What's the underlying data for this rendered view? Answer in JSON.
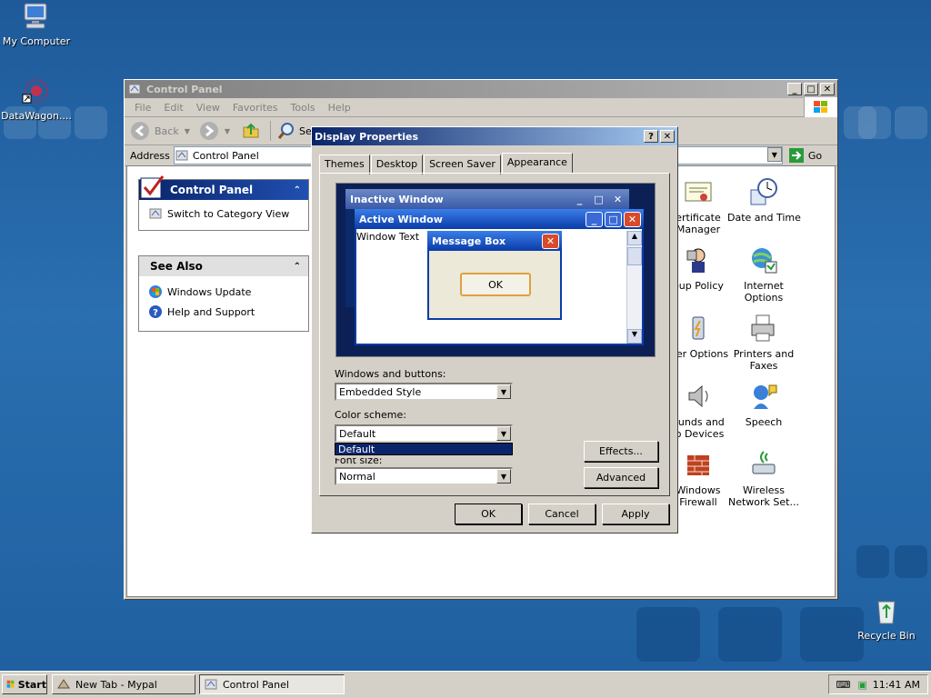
{
  "desktop": {
    "icons": [
      {
        "label": "My Computer"
      },
      {
        "label": "DataWagon...."
      },
      {
        "label": "Recycle Bin"
      }
    ]
  },
  "control_panel": {
    "title": "Control Panel",
    "menu": [
      "File",
      "Edit",
      "View",
      "Favorites",
      "Tools",
      "Help"
    ],
    "toolbar": {
      "back": "Back",
      "search": "Se"
    },
    "address_label": "Address",
    "address_value": "Control Panel",
    "go_label": "Go",
    "task_panel": {
      "title": "Control Panel",
      "link": "Switch to Category View"
    },
    "see_also": {
      "title": "See Also",
      "links": [
        "Windows Update",
        "Help and Support"
      ]
    },
    "items": [
      {
        "label": "ertificate\nManager"
      },
      {
        "label": "Date and Time"
      },
      {
        "label": "oup Policy"
      },
      {
        "label": "Internet\nOptions"
      },
      {
        "label": "wer Options"
      },
      {
        "label": "Printers and\nFaxes"
      },
      {
        "label": "ounds and\nio Devices"
      },
      {
        "label": "Speech"
      },
      {
        "label": "Windows\nFirewall"
      },
      {
        "label": "Wireless\nNetwork Set..."
      }
    ]
  },
  "dialog": {
    "title": "Display Properties",
    "tabs": [
      "Themes",
      "Desktop",
      "Screen Saver",
      "Appearance"
    ],
    "active_tab": "Appearance",
    "preview": {
      "inactive_title": "Inactive Window",
      "active_title": "Active Window",
      "window_text": "Window Text",
      "message_title": "Message Box",
      "ok": "OK"
    },
    "windows_buttons_label": "Windows and buttons:",
    "windows_buttons_value": "Embedded Style",
    "color_scheme_label": "Color scheme:",
    "color_scheme_value": "Default",
    "color_scheme_option": "Default",
    "font_size_label": "Font size:",
    "font_size_value": "Normal",
    "effects": "Effects...",
    "advanced": "Advanced",
    "ok": "OK",
    "cancel": "Cancel",
    "apply": "Apply"
  },
  "taskbar": {
    "start": "Start",
    "tasks": [
      {
        "label": "New Tab - Mypal"
      },
      {
        "label": "Control Panel"
      }
    ],
    "time": "11:41 AM"
  },
  "colors": {
    "active_title": "#0a246a",
    "xp_blue": "#0a3ba8",
    "desktop": "#1f5f9f",
    "selection": "#0a246a"
  }
}
